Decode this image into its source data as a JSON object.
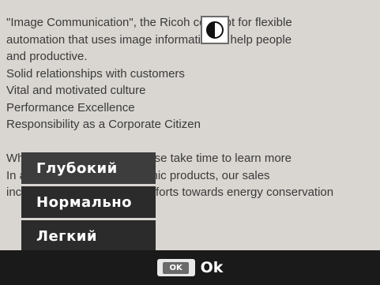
{
  "background_text": [
    "\"Image Communication\", the Ricoh concept for flexible",
    "automation that uses image information to help people",
    "and productive.",
    "Solid relationships with customers",
    "Vital and motivated culture",
    "Performance Excellence",
    "Responsibility as a Corporate Citizen",
    "",
    "When you visit our site, please take time to learn more",
    "In addition to our photographic products, our sales",
    "include information on our efforts towards energy conservation"
  ],
  "setting_icon": "contrast-icon",
  "menu": {
    "items": [
      {
        "label": "Глубокий",
        "selected": true
      },
      {
        "label": "Нормально",
        "selected": false
      },
      {
        "label": "Легкий",
        "selected": false
      }
    ]
  },
  "footer": {
    "ok_badge": "OK",
    "ok_label": "Ok"
  },
  "colors": {
    "menu_selected": "#3d3d3d",
    "menu_unselected": "#2b2b2b",
    "footer_bg": "#1a1a1a"
  }
}
